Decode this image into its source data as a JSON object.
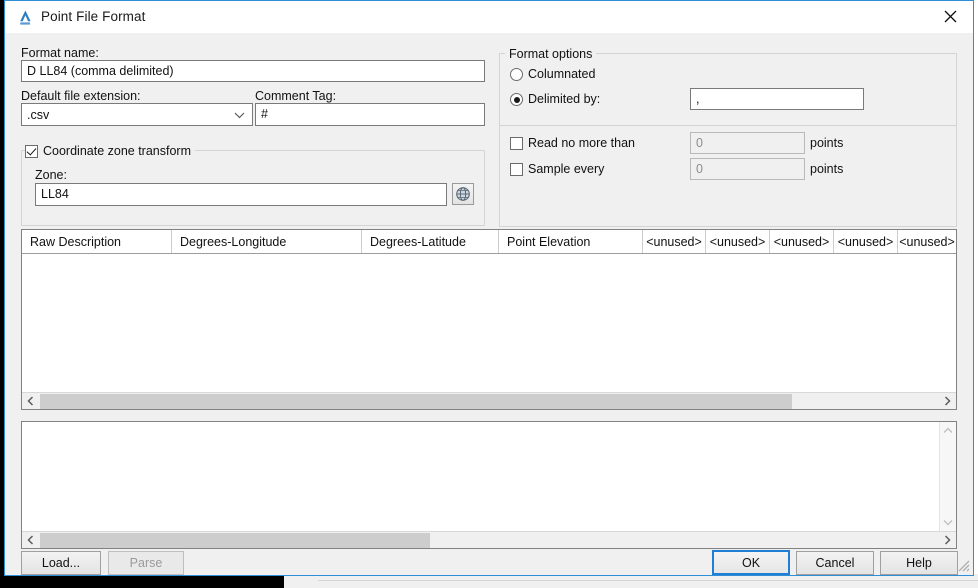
{
  "window": {
    "title": "Point File Format",
    "app_icon": "autocad-a-icon",
    "close_icon": "close-icon",
    "accent_color": "#2e8fd6"
  },
  "form": {
    "format_name_label": "Format name:",
    "format_name_value": "D LL84 (comma delimited)",
    "default_ext_label": "Default file extension:",
    "default_ext_value": ".csv",
    "comment_tag_label": "Comment Tag:",
    "comment_tag_value": "#"
  },
  "coordinate_zone": {
    "group_label": "Coordinate zone transform",
    "checked": true,
    "zone_label": "Zone:",
    "zone_value": "LL84",
    "globe_icon": "globe-icon"
  },
  "format_options": {
    "group_label": "Format options",
    "columnated_label": "Columnated",
    "columnated_selected": false,
    "delimited_label": "Delimited by:",
    "delimited_selected": true,
    "delimiter_value": ",",
    "read_no_more_label": "Read no more than",
    "read_no_more_checked": false,
    "read_no_more_value": "0",
    "read_no_more_units": "points",
    "sample_every_label": "Sample every",
    "sample_every_checked": false,
    "sample_every_value": "0",
    "sample_every_units": "points"
  },
  "table": {
    "columns": [
      {
        "label": "Raw Description",
        "align": "left"
      },
      {
        "label": "Degrees-Longitude",
        "align": "left"
      },
      {
        "label": "Degrees-Latitude",
        "align": "left"
      },
      {
        "label": "Point Elevation",
        "align": "left"
      },
      {
        "label": "<unused>",
        "align": "center"
      },
      {
        "label": "<unused>",
        "align": "center"
      },
      {
        "label": "<unused>",
        "align": "center"
      },
      {
        "label": "<unused>",
        "align": "center"
      },
      {
        "label": "<unused>",
        "align": "center"
      }
    ],
    "rows": []
  },
  "preview": {
    "content": ""
  },
  "scrollbars": {
    "left_arrow_icon": "chevron-left-icon",
    "right_arrow_icon": "chevron-right-icon",
    "up_arrow_icon": "chevron-up-icon",
    "down_arrow_icon": "chevron-down-icon"
  },
  "buttons": {
    "load": "Load...",
    "parse": "Parse",
    "parse_enabled": false,
    "ok": "OK",
    "cancel": "Cancel",
    "help": "Help"
  }
}
